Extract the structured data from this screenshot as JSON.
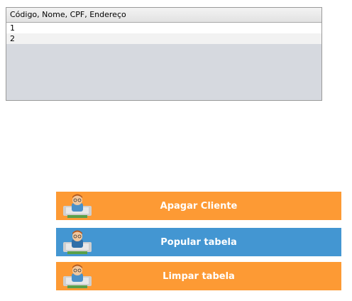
{
  "table": {
    "header": "Código, Nome, CPF, Endereço",
    "rows": [
      "1",
      "2"
    ]
  },
  "buttons": {
    "apagar": {
      "label": "Apagar Cliente",
      "color": "#fd9a34",
      "icon": "programmer-mascot-icon"
    },
    "popular": {
      "label": "Popular tabela",
      "color": "#4396d2",
      "icon": "programmer-mascot-icon"
    },
    "limpar": {
      "label": "Limpar tabela",
      "color": "#fd9a34",
      "icon": "programmer-mascot-icon"
    }
  }
}
